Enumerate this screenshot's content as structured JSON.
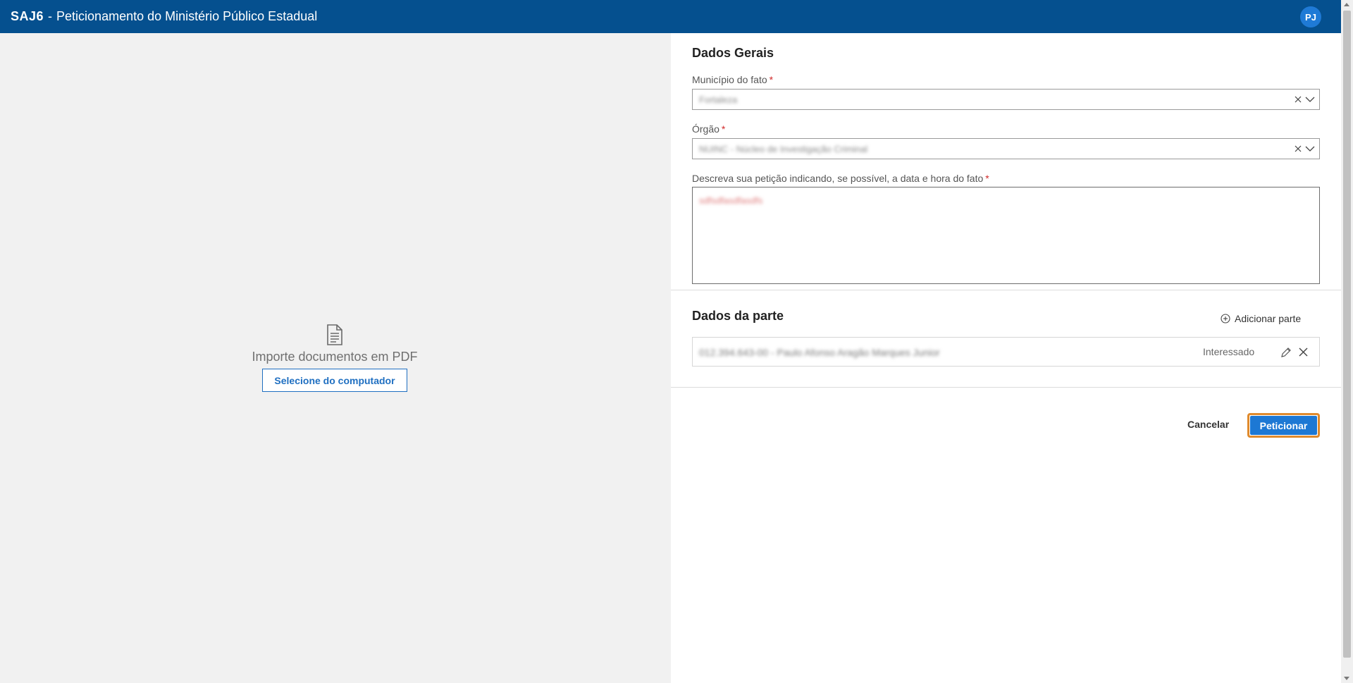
{
  "header": {
    "brand": "SAJ6",
    "separator": "-",
    "title": "Peticionamento do Ministério Público Estadual",
    "user_initials": "PJ"
  },
  "upload": {
    "icon": "document-icon",
    "text": "Importe documentos em PDF",
    "button_label": "Selecione do computador"
  },
  "general": {
    "title": "Dados Gerais",
    "municipio": {
      "label": "Município do fato",
      "required": "*",
      "value": "Fortaleza"
    },
    "orgao": {
      "label": "Órgão",
      "required": "*",
      "value": "NUINC - Núcleo de Investigação Criminal"
    },
    "descricao": {
      "label": "Descreva sua petição indicando, se possível, a data e hora do fato",
      "required": "*",
      "value": "sdfsdfasdfasdfs"
    }
  },
  "parties": {
    "title": "Dados da parte",
    "add_label": "Adicionar parte",
    "items": [
      {
        "name": "012.394.643-00 - Paulo Afonso Aragão Marques Junior",
        "role": "Interessado"
      }
    ]
  },
  "actions": {
    "cancel_label": "Cancelar",
    "submit_label": "Peticionar"
  },
  "colors": {
    "header_bg": "#05508f",
    "primary": "#1d78d4",
    "focus_outline": "#e08a2c",
    "required": "#d12b2b"
  }
}
